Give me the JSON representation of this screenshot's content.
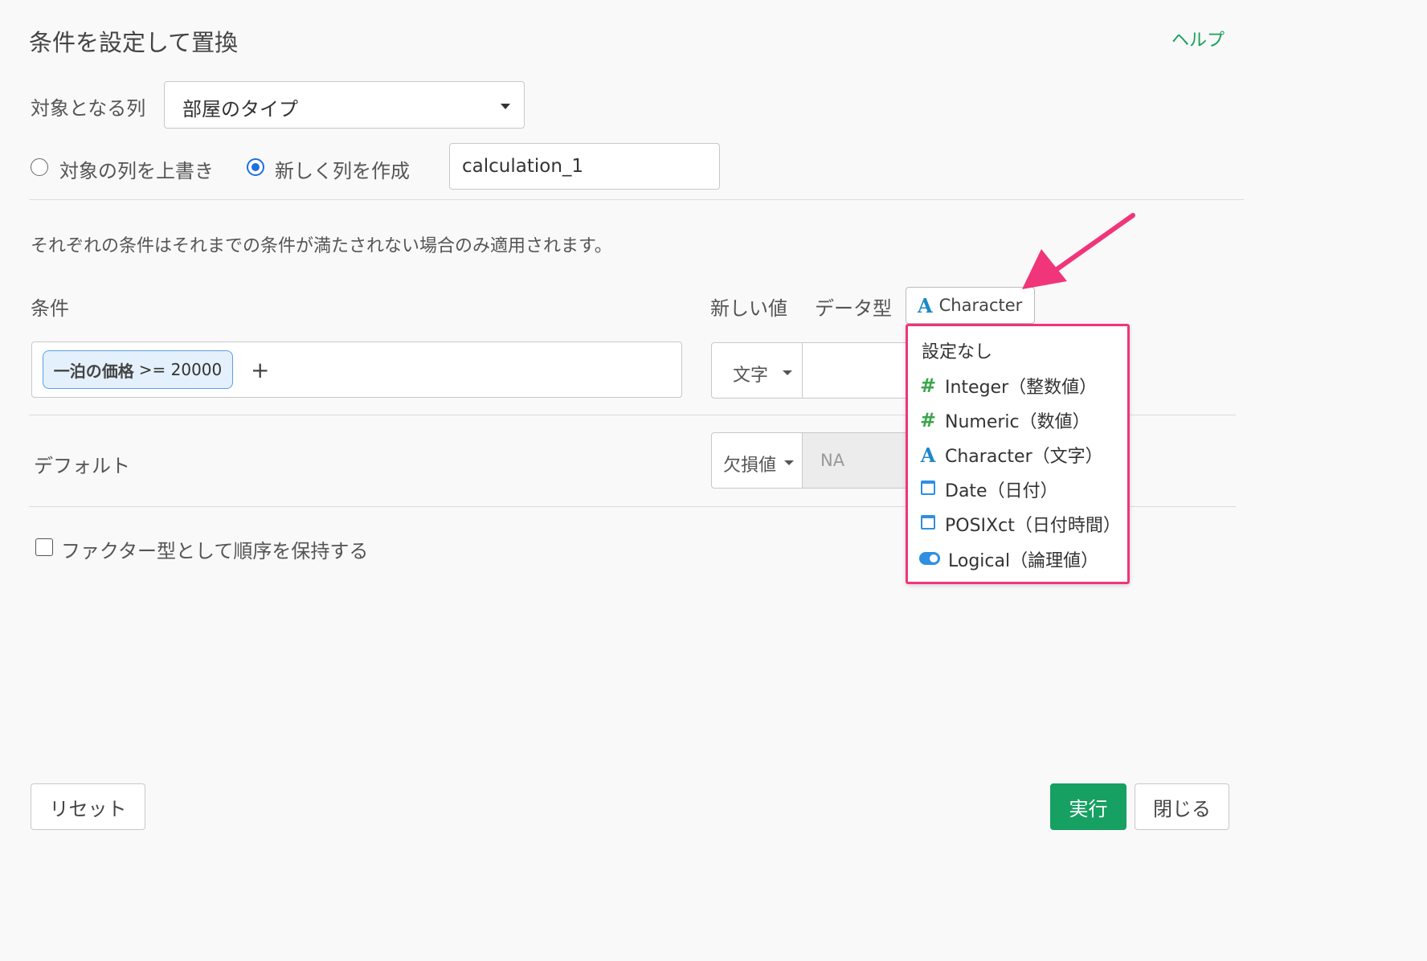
{
  "dialog": {
    "title": "条件を設定して置換",
    "help_label": "ヘルプ"
  },
  "target_column": {
    "label": "対象となる列",
    "value": "部屋のタイプ"
  },
  "mode": {
    "overwrite_label": "対象の列を上書き",
    "new_column_label": "新しく列を作成",
    "selected": "new_column",
    "new_column_name": "calculation_1"
  },
  "note": "それぞれの条件はそれまでの条件が満たされない場合のみ適用されます。",
  "headers": {
    "condition": "条件",
    "new_value": "新しい値",
    "data_type": "データ型"
  },
  "data_type_button": {
    "label": "Character",
    "icon": "character-icon"
  },
  "condition_row": {
    "chip_column": "一泊の価格",
    "chip_expr": ">= 20000",
    "add_symbol": "+",
    "value_type": "文字",
    "value": ""
  },
  "default_row": {
    "label": "デフォルト",
    "value_type": "欠損値",
    "placeholder": "NA"
  },
  "factor_checkbox": {
    "label": "ファクター型として順序を保持する",
    "checked": false
  },
  "dropdown": {
    "highlight_color": "#f0357a",
    "items": [
      {
        "label": "設定なし",
        "icon": "none"
      },
      {
        "label": "Integer（整数値）",
        "icon": "hash-icon"
      },
      {
        "label": "Numeric（数値）",
        "icon": "hash-icon"
      },
      {
        "label": "Character（文字）",
        "icon": "character-icon"
      },
      {
        "label": "Date（日付）",
        "icon": "calendar-icon"
      },
      {
        "label": "POSIXct（日付時間）",
        "icon": "calendar-icon"
      },
      {
        "label": "Logical（論理値）",
        "icon": "toggle-icon"
      }
    ]
  },
  "footer": {
    "reset_label": "リセット",
    "run_label": "実行",
    "close_label": "閉じる",
    "accent_color": "#16a062"
  }
}
